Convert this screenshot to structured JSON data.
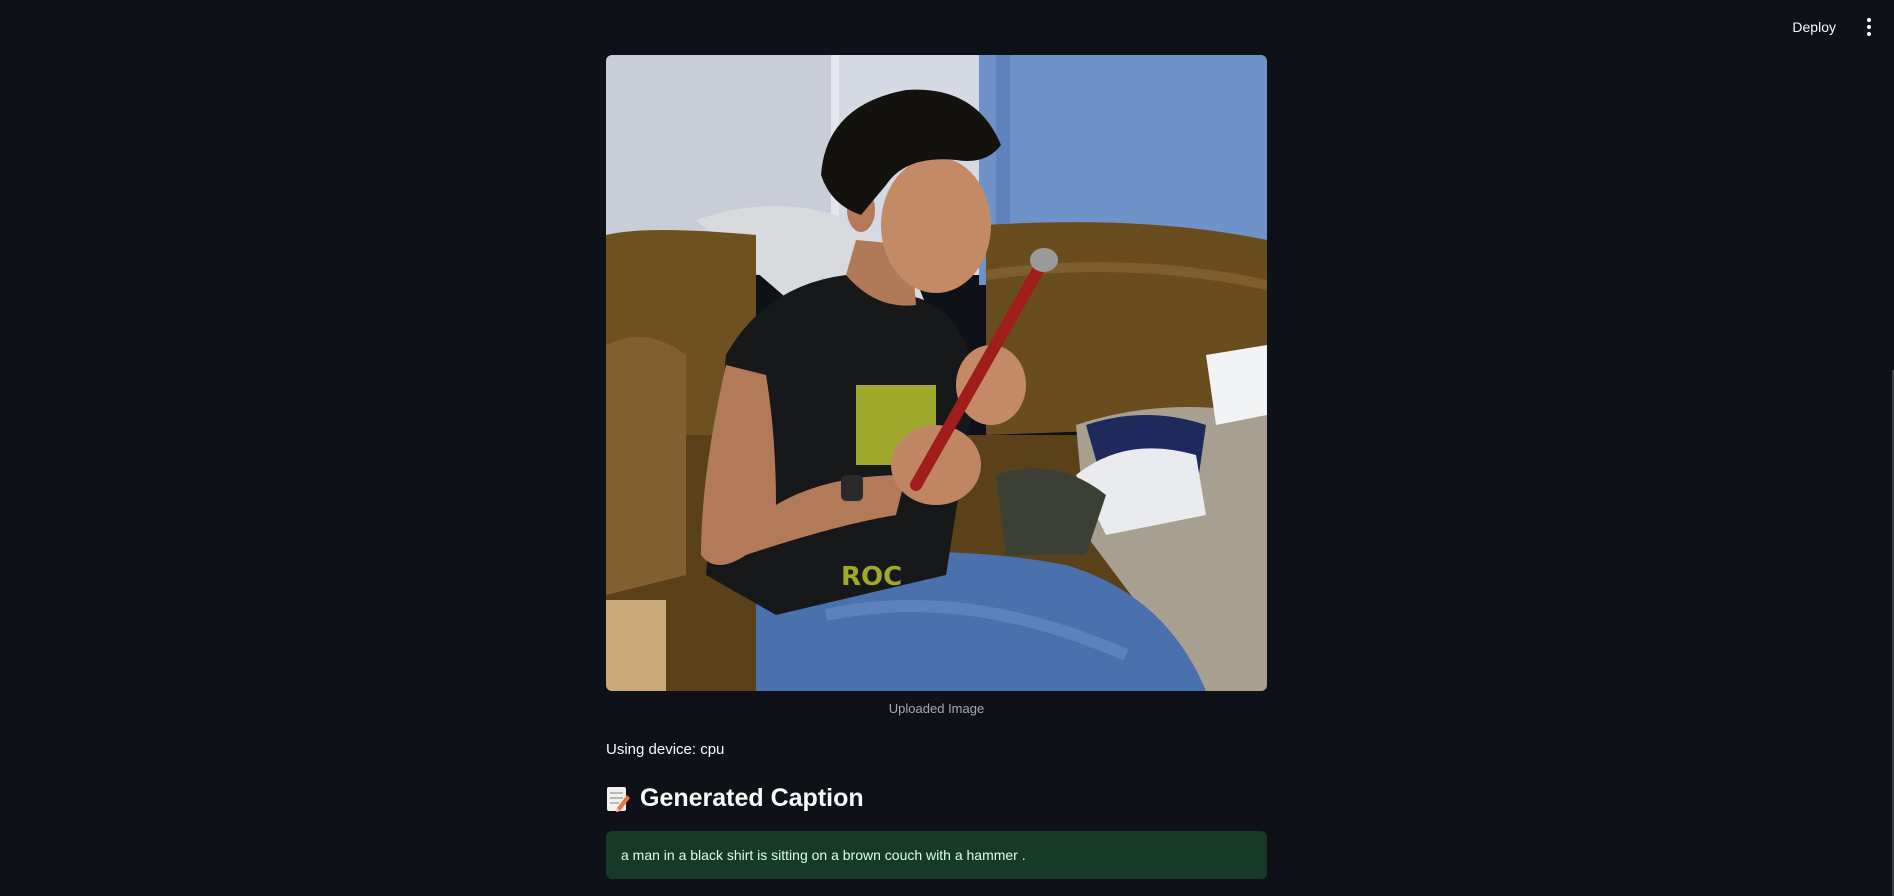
{
  "header": {
    "deploy_label": "Deploy",
    "menu_icon": "vertical-ellipsis-icon"
  },
  "main": {
    "image_caption": "Uploaded Image",
    "device_text": "Using device: cpu",
    "section_heading": "Generated Caption",
    "section_icon": "memo-icon",
    "generated_caption": "a man in a black shirt is sitting on a brown couch with a hammer ."
  },
  "colors": {
    "background": "#0e1117",
    "success_background": "#173928",
    "success_text": "#dffde9",
    "muted_text": "#a3a8b4"
  }
}
